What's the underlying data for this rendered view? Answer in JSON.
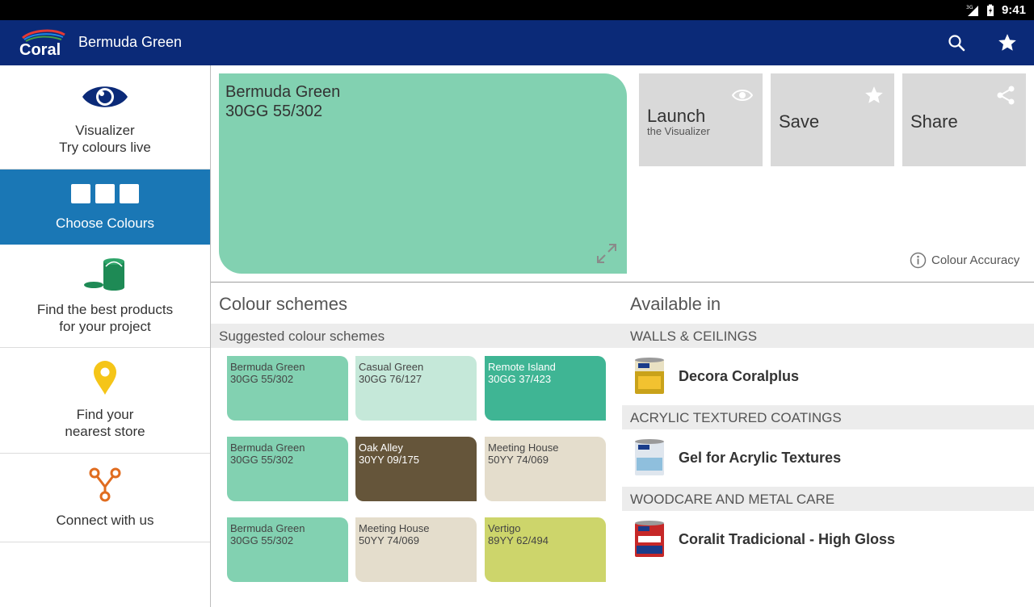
{
  "status_bar": {
    "time": "9:41",
    "network": "3G"
  },
  "app_bar": {
    "title": "Bermuda Green",
    "logo_text": "Coral"
  },
  "sidebar": {
    "items": [
      {
        "line1": "Visualizer",
        "line2": "Try colours live"
      },
      {
        "line1": "Choose Colours",
        "line2": ""
      },
      {
        "line1": "Find the best products",
        "line2": "for your project"
      },
      {
        "line1": "Find your",
        "line2": "nearest store"
      },
      {
        "line1": "Connect with us",
        "line2": ""
      }
    ]
  },
  "swatch": {
    "name": "Bermuda Green",
    "code": "30GG 55/302",
    "color": "#82d1b1"
  },
  "actions": {
    "launch": {
      "label": "Launch",
      "sub": "the Visualizer"
    },
    "save": {
      "label": "Save"
    },
    "share": {
      "label": "Share"
    }
  },
  "accuracy": {
    "label": "Colour Accuracy"
  },
  "schemes": {
    "title": "Colour schemes",
    "subtitle": "Suggested colour schemes",
    "chips": [
      {
        "name": "Bermuda Green",
        "code": "30GG 55/302",
        "color": "#82d1b1"
      },
      {
        "name": "Casual Green",
        "code": "30GG 76/127",
        "color": "#c5e8d9"
      },
      {
        "name": "Remote Island",
        "code": "30GG 37/423",
        "color": "#3fb594"
      },
      {
        "name": "Bermuda Green",
        "code": "30GG 55/302",
        "color": "#82d1b1"
      },
      {
        "name": "Oak Alley",
        "code": "30YY 09/175",
        "color": "#65553a"
      },
      {
        "name": "Meeting House",
        "code": "50YY 74/069",
        "color": "#e4ddcc"
      },
      {
        "name": "Bermuda Green",
        "code": "30GG 55/302",
        "color": "#82d1b1"
      },
      {
        "name": "Meeting House",
        "code": "50YY 74/069",
        "color": "#e4ddcc"
      },
      {
        "name": "Vertigo",
        "code": "89YY 62/494",
        "color": "#cdd56b"
      }
    ]
  },
  "available": {
    "title": "Available in",
    "categories": [
      {
        "heading": "WALLS & CEILINGS",
        "product": "Decora Coralplus"
      },
      {
        "heading": "ACRYLIC TEXTURED COATINGS",
        "product": "Gel for Acrylic Textures"
      },
      {
        "heading": "WOODCARE AND METAL CARE",
        "product": "Coralit Tradicional - High Gloss"
      }
    ]
  },
  "colors": {
    "primary": "#0b2a78",
    "active": "#1a77b5",
    "green_icon": "#1e8a55",
    "pin": "#f5c518",
    "connect": "#e06c1f"
  }
}
